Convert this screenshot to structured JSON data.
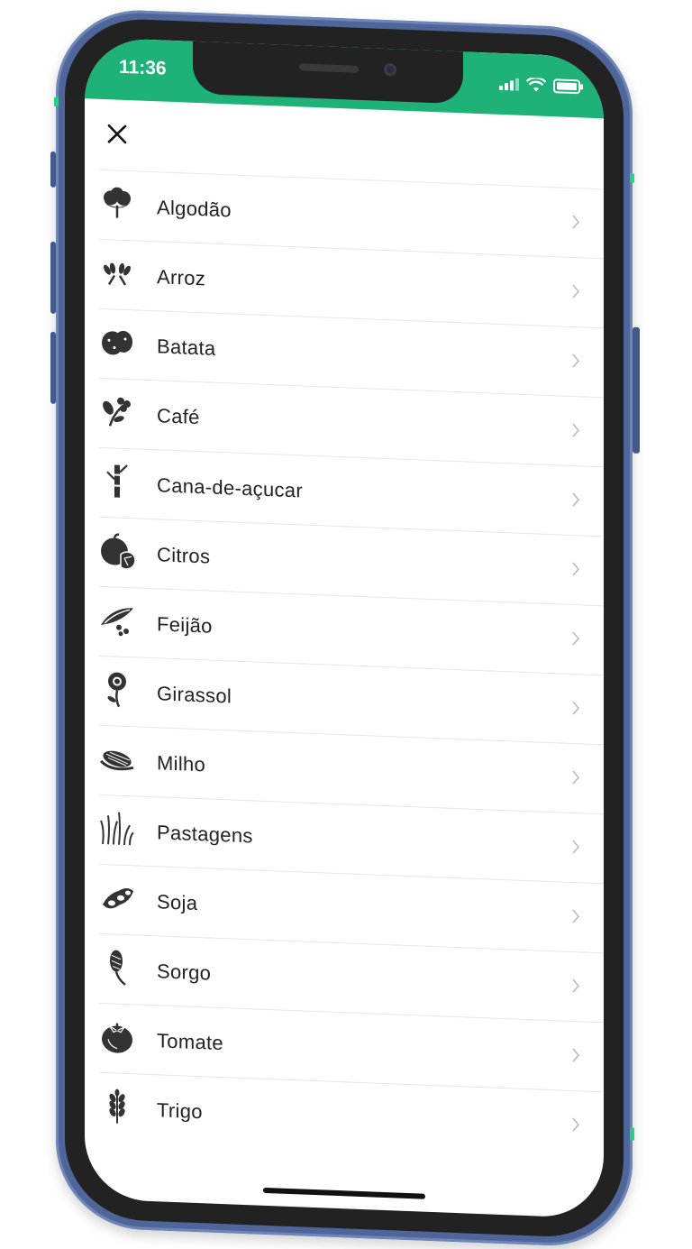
{
  "status_bar": {
    "time": "11:36"
  },
  "toolbar": {
    "close_icon": "close-icon"
  },
  "crops": [
    {
      "label": "Algodão",
      "icon": "cotton-icon"
    },
    {
      "label": "Arroz",
      "icon": "rice-icon"
    },
    {
      "label": "Batata",
      "icon": "potato-icon"
    },
    {
      "label": "Café",
      "icon": "coffee-icon"
    },
    {
      "label": "Cana-de-açucar",
      "icon": "sugarcane-icon"
    },
    {
      "label": "Citros",
      "icon": "citrus-icon"
    },
    {
      "label": "Feijão",
      "icon": "bean-icon"
    },
    {
      "label": "Girassol",
      "icon": "sunflower-icon"
    },
    {
      "label": "Milho",
      "icon": "corn-icon"
    },
    {
      "label": "Pastagens",
      "icon": "pasture-icon"
    },
    {
      "label": "Soja",
      "icon": "soy-icon"
    },
    {
      "label": "Sorgo",
      "icon": "sorghum-icon"
    },
    {
      "label": "Tomate",
      "icon": "tomato-icon"
    },
    {
      "label": "Trigo",
      "icon": "wheat-icon"
    }
  ],
  "colors": {
    "status_bar": "#1fb278",
    "frame": "#4e6699",
    "icon": "#333333"
  }
}
